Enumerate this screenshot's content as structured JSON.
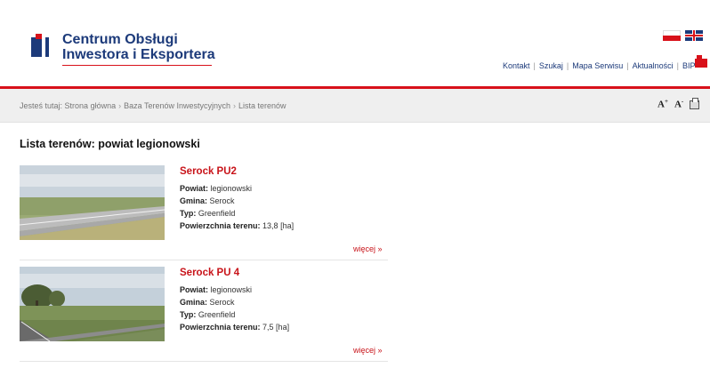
{
  "header": {
    "logo_line1": "Centrum Obsługi",
    "logo_line2": "Inwestora i Eksportera",
    "nav": [
      "Kontakt",
      "Szukaj",
      "Mapa Serwisu",
      "Aktualności",
      "BIP"
    ],
    "brand_color": "#1c3a7a",
    "accent_color": "#d8111a"
  },
  "breadcrumb": {
    "prefix": "Jesteś tutaj:",
    "items": [
      "Strona główna",
      "Baza Terenów Inwestycyjnych",
      "Lista terenów"
    ],
    "separator": "›"
  },
  "tools": {
    "increase_font": "A",
    "decrease_font": "A",
    "increase_mark": "+",
    "decrease_mark": "-"
  },
  "page": {
    "title": "Lista terenów: powiat legionowski"
  },
  "labels": {
    "powiat": "Powiat:",
    "gmina": "Gmina:",
    "typ": "Typ:",
    "area": "Powierzchnia terenu:",
    "more": "więcej »"
  },
  "items": [
    {
      "title": "Serock PU2",
      "powiat": "legionowski",
      "gmina": "Serock",
      "typ": "Greenfield",
      "area": "13,8 [ha]"
    },
    {
      "title": "Serock PU 4",
      "powiat": "legionowski",
      "gmina": "Serock",
      "typ": "Greenfield",
      "area": "7,5 [ha]"
    }
  ]
}
